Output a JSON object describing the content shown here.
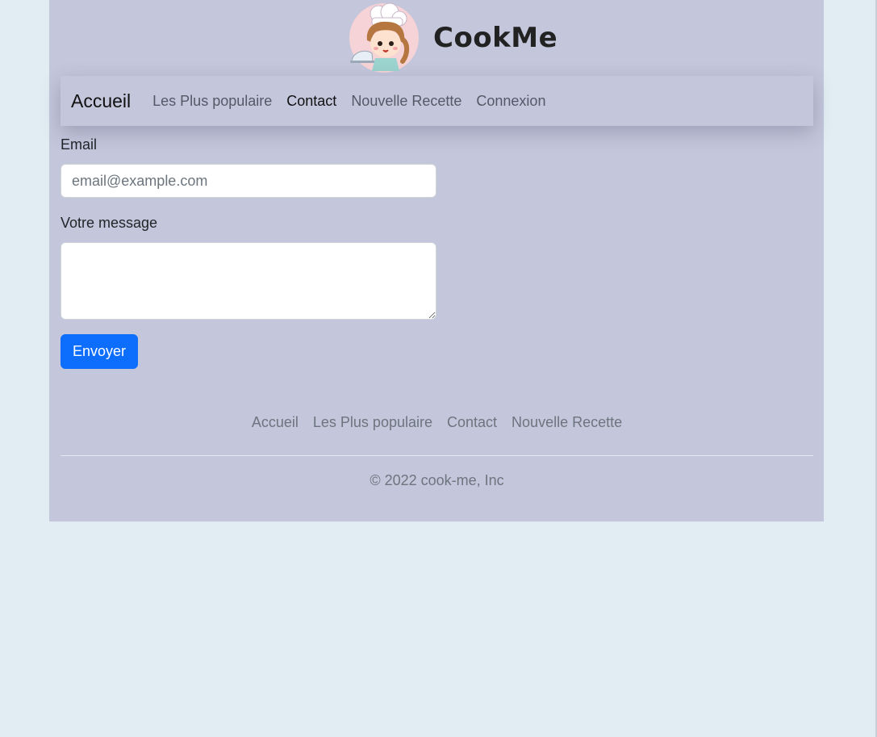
{
  "brand": {
    "name": "CookMe",
    "logo_icon": "chef-girl-logo-icon"
  },
  "navbar": {
    "brand": "Accueil",
    "links": [
      {
        "label": "Les Plus populaire",
        "active": false
      },
      {
        "label": "Contact",
        "active": true
      },
      {
        "label": "Nouvelle Recette",
        "active": false
      },
      {
        "label": "Connexion",
        "active": false
      }
    ]
  },
  "form": {
    "email_label": "Email",
    "email_placeholder": "email@example.com",
    "email_value": "",
    "message_label": "Votre message",
    "message_value": "",
    "submit_label": "Envoyer"
  },
  "footer": {
    "links": [
      {
        "label": "Accueil"
      },
      {
        "label": "Les Plus populaire"
      },
      {
        "label": "Contact"
      },
      {
        "label": "Nouvelle Recette"
      }
    ],
    "copyright": "© 2022 cook-me, Inc"
  },
  "colors": {
    "background": "#e2edf3",
    "page": "#c4c6dc",
    "primary_button": "#0d6efd",
    "muted_text": "#6c757d"
  }
}
